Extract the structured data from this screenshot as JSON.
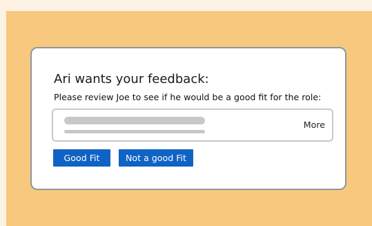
{
  "card": {
    "title": "Ari wants your feedback:",
    "message": "Please review Joe to see if he would be a good fit for the role:",
    "more_link": "More",
    "buttons": {
      "good_fit": "Good Fit",
      "not_good_fit": "Not a good Fit"
    }
  },
  "colors": {
    "page_background": "#fdf2e3",
    "panel_background": "#f8c87e",
    "card_border": "#8c979c",
    "placeholder_gray": "#c8c8c8",
    "button_blue": "#0f63c5"
  }
}
